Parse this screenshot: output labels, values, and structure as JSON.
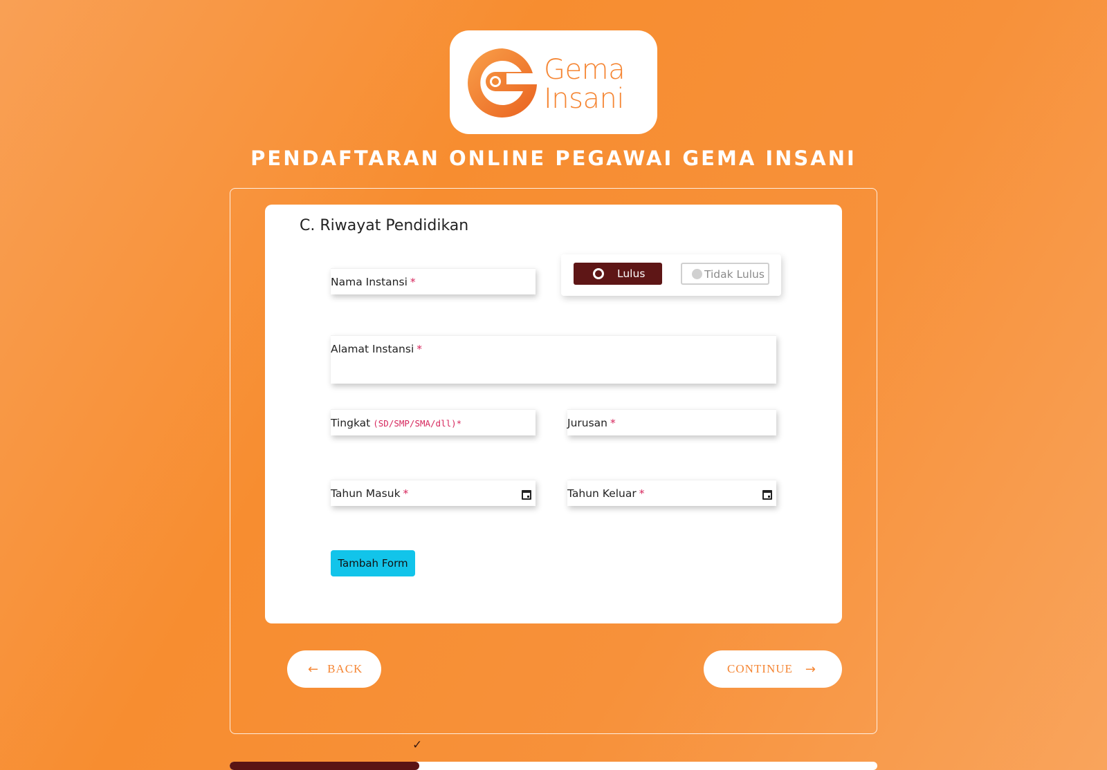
{
  "brand": {
    "logo_line1": "Gema",
    "logo_line2": "Insani",
    "accent": "#f58634",
    "dark": "#5e1616"
  },
  "page_title": "PENDAFTARAN ONLINE PEGAWAI GEMA INSANI",
  "section": {
    "title": "C. Riwayat Pendidikan",
    "fields": {
      "nama_instansi": {
        "label": "Nama Instansi",
        "required": "*"
      },
      "alamat_instansi": {
        "label": "Alamat Instansi",
        "required": "*"
      },
      "tingkat": {
        "label": "Tingkat",
        "hint": "(SD/SMP/SMA/dll)*"
      },
      "jurusan": {
        "label": "Jurusan",
        "required": "*"
      },
      "tahun_masuk": {
        "label": "Tahun Masuk",
        "required": "*",
        "icon": "calendar-icon"
      },
      "tahun_keluar": {
        "label": "Tahun Keluar",
        "required": "*",
        "icon": "calendar-icon"
      }
    },
    "status_options": [
      {
        "label": "Lulus",
        "selected": true
      },
      {
        "label": "Tidak Lulus",
        "selected": false
      }
    ],
    "add_button": "Tambah Form"
  },
  "nav": {
    "back_label": "BACK",
    "back_icon": "arrow-left-icon",
    "continue_label": "CONTINUE",
    "continue_icon": "arrow-right-icon"
  },
  "progress": {
    "fraction": 0.293,
    "completed_icon": "check-icon"
  }
}
